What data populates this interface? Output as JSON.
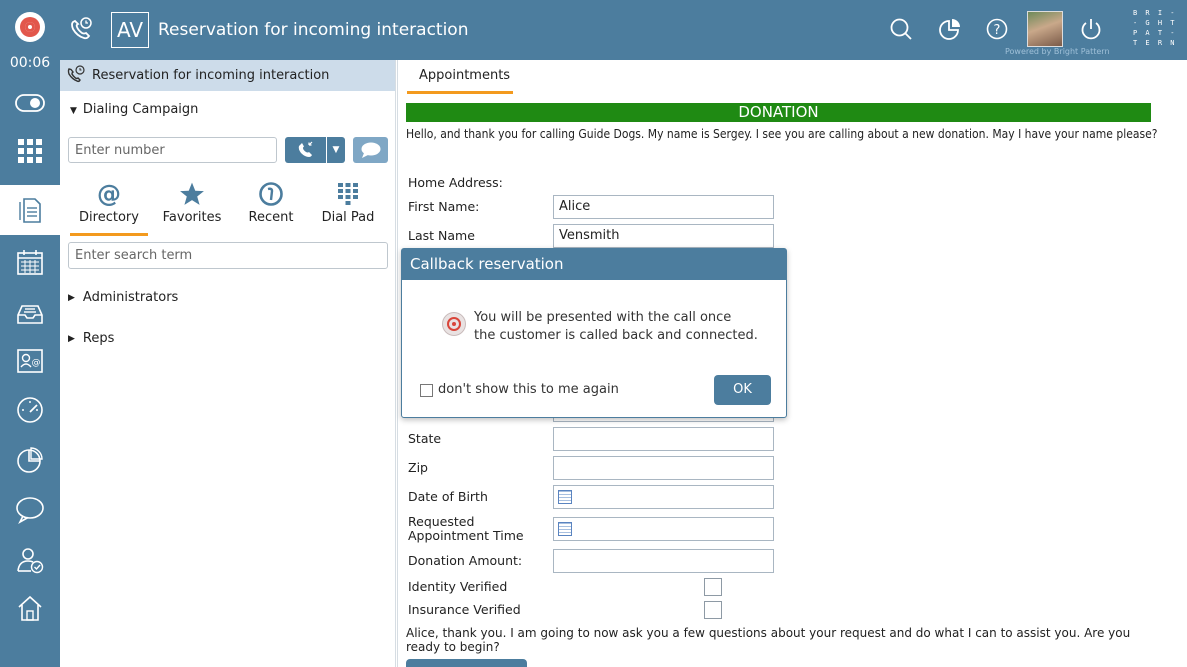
{
  "header": {
    "initials": "AV",
    "title": "Reservation for incoming interaction",
    "powered_by": "Powered by Bright Pattern",
    "brand_lines": [
      "B R I -",
      "- G H T",
      "P A T -",
      "T E R N"
    ]
  },
  "rail": {
    "timer": "00:06",
    "items": [
      "status-toggle-icon",
      "dialpad-grid-icon",
      "document-icon",
      "calendar-icon",
      "inbox-icon",
      "contact-card-icon",
      "dashboard-gauge-icon",
      "pie-chart-icon",
      "chat-bubble-icon",
      "user-check-icon",
      "home-icon"
    ]
  },
  "left_panel": {
    "header": "Reservation for incoming interaction",
    "campaign": "Dialing Campaign",
    "number_placeholder": "Enter number",
    "tabs": [
      {
        "label": "Directory",
        "icon": "at-icon"
      },
      {
        "label": "Favorites",
        "icon": "star-icon"
      },
      {
        "label": "Recent",
        "icon": "recent-icon"
      },
      {
        "label": "Dial Pad",
        "icon": "dialpad-icon"
      }
    ],
    "search_placeholder": "Enter search term",
    "tree": [
      "Administrators",
      "Reps"
    ]
  },
  "main": {
    "tab": "Appointments",
    "banner": "DONATION",
    "script_intro": "Hello, and thank you for calling Guide Dogs. My name is Sergey. I see you are calling about a new donation. May I have your name please?",
    "section_label": "Home Address:",
    "fields": {
      "first_name": {
        "label": "First Name:",
        "value": "Alice"
      },
      "last_name": {
        "label": "Last Name",
        "value": "Vensmith"
      },
      "state": {
        "label": "State",
        "value": ""
      },
      "zip": {
        "label": "Zip",
        "value": ""
      },
      "dob": {
        "label": "Date of Birth",
        "value": ""
      },
      "appt_time": {
        "label": "Requested Appointment Time",
        "value": ""
      },
      "donation": {
        "label": "Donation Amount:",
        "value": ""
      },
      "identity": {
        "label": "Identity Verified"
      },
      "insurance": {
        "label": "Insurance Verified"
      }
    },
    "script_followup": "Alice, thank you. I am going to now ask you a few questions about your request and do what I can to assist you. Are you ready to begin?"
  },
  "dialog": {
    "title": "Callback reservation",
    "message_line1": "You will be presented with the call once",
    "message_line2": "the customer is called back and connected.",
    "checkbox_label": "don't show this to me again",
    "ok_label": "OK"
  },
  "colors": {
    "primary": "#4c7d9e",
    "accent": "#f39a1e",
    "banner": "#1f8a13",
    "logo": "#e2574c"
  }
}
